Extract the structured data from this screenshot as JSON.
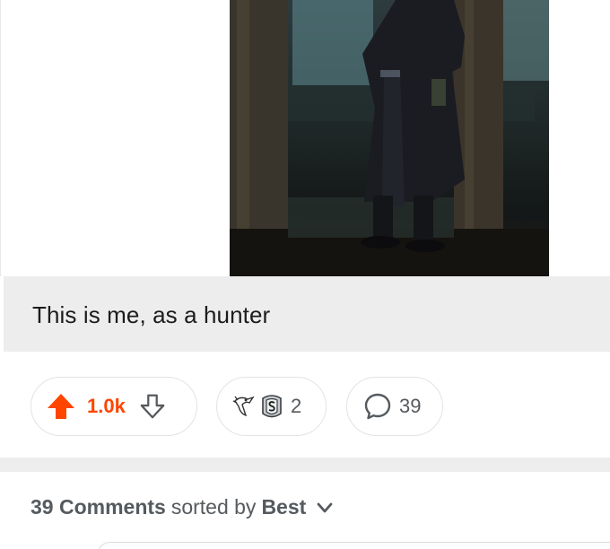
{
  "post": {
    "caption": "This is me, as a hunter"
  },
  "actions": {
    "vote_count": "1.0k",
    "award_count": "2",
    "comment_count": "39"
  },
  "comments_header": {
    "count_label": "39 Comments",
    "sorted_by_label": "sorted by",
    "sort_value": "Best"
  },
  "colors": {
    "upvote_active": "#ff4500",
    "muted_text": "#555a5e",
    "caption_bg": "#ededee"
  },
  "icons": {
    "upvote": "arrow-up-icon",
    "downvote": "arrow-down-icon",
    "award_1": "gesture-hand-award-icon",
    "award_2": "silver-award-icon",
    "comments": "speech-bubble-icon",
    "sort": "chevron-down-icon"
  }
}
